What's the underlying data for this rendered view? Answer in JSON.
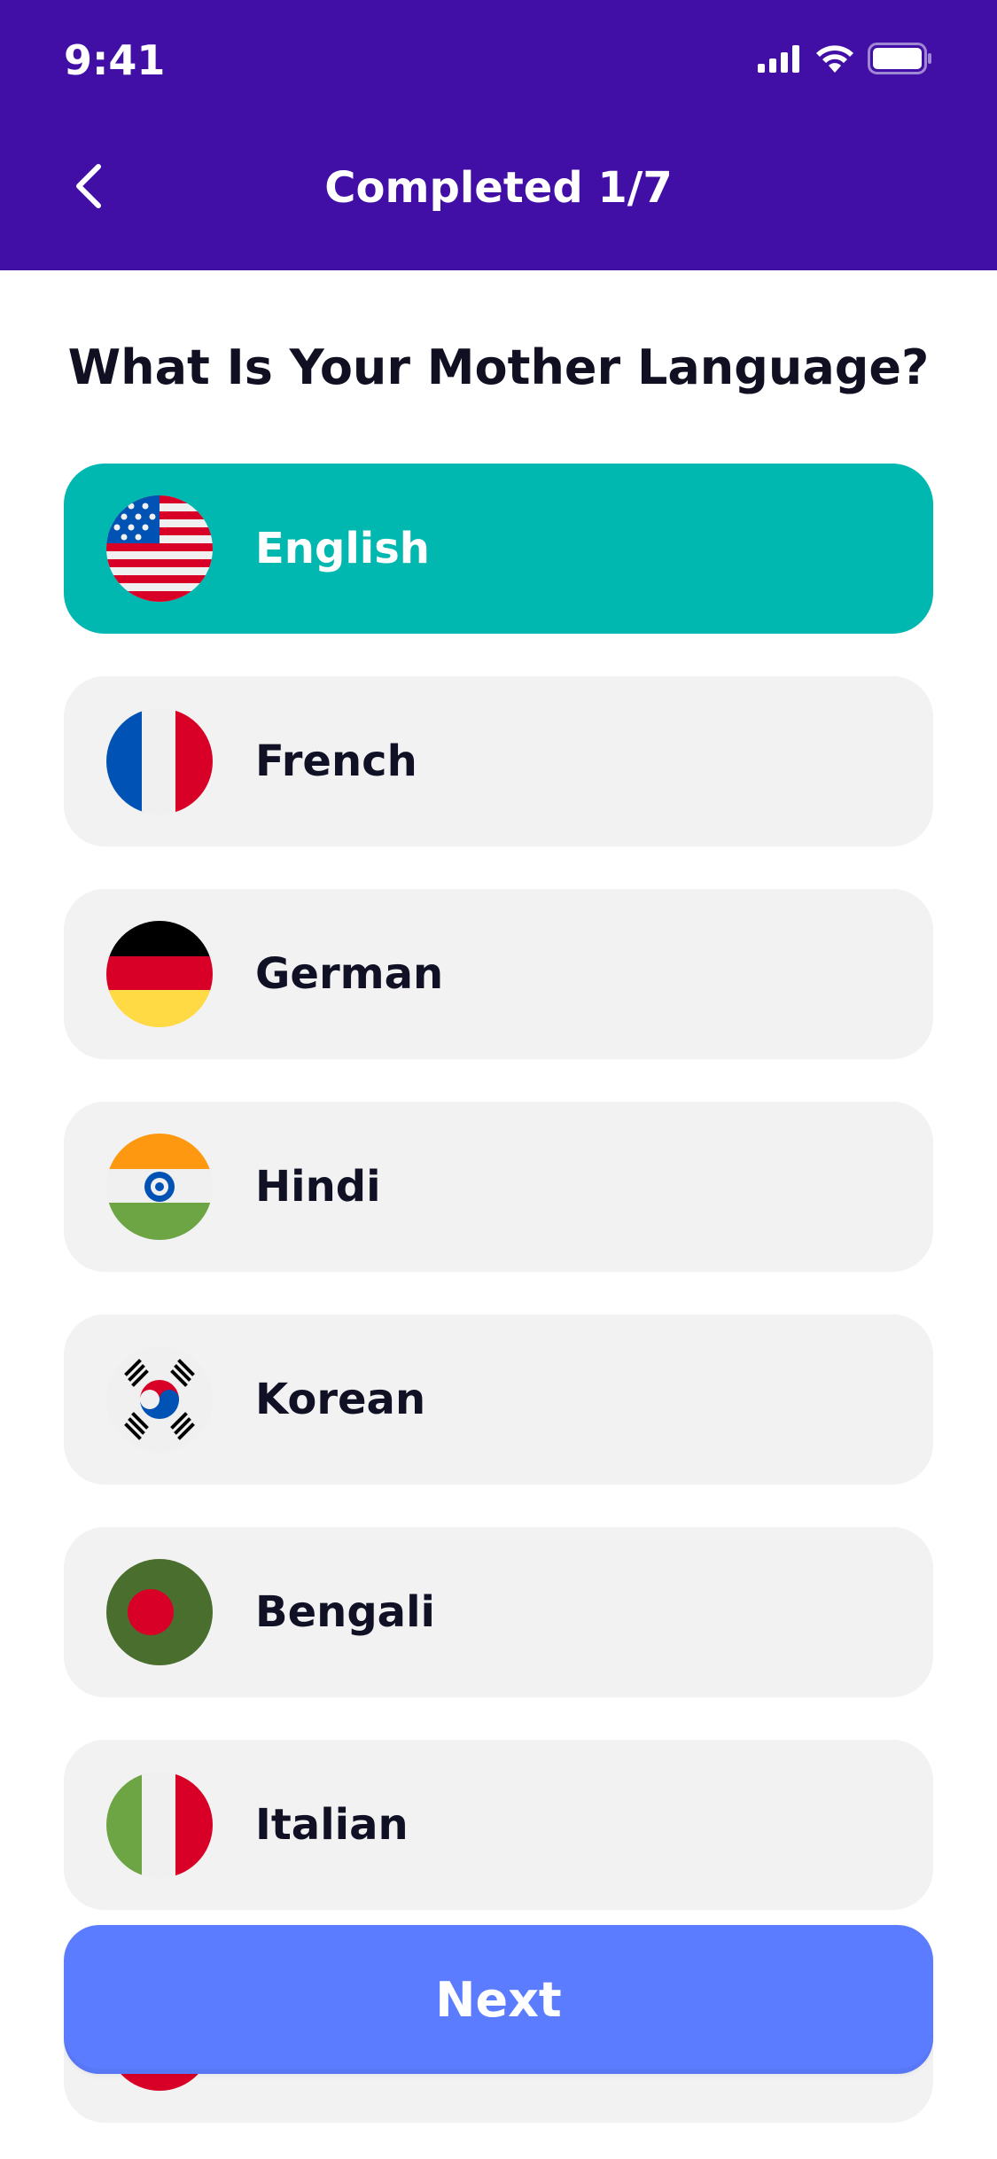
{
  "status_bar": {
    "time": "9:41"
  },
  "header": {
    "title": "Completed 1/7"
  },
  "question": "What Is Your Mother Language?",
  "languages": [
    {
      "label": "English",
      "flag": "usa-flag-icon",
      "selected": true
    },
    {
      "label": "French",
      "flag": "france-flag-icon",
      "selected": false
    },
    {
      "label": "German",
      "flag": "germany-flag-icon",
      "selected": false
    },
    {
      "label": "Hindi",
      "flag": "india-flag-icon",
      "selected": false
    },
    {
      "label": "Korean",
      "flag": "south-korea-flag-icon",
      "selected": false
    },
    {
      "label": "Bengali",
      "flag": "bangladesh-flag-icon",
      "selected": false
    },
    {
      "label": "Italian",
      "flag": "italy-flag-icon",
      "selected": false
    },
    {
      "label": "",
      "flag": "red-flag-icon",
      "selected": false
    }
  ],
  "next_button": {
    "label": "Next"
  },
  "colors": {
    "header": "#410FA6",
    "selected": "#00B8B0",
    "item_bg": "#F2F2F2",
    "next_button": "#5C7CFF"
  }
}
